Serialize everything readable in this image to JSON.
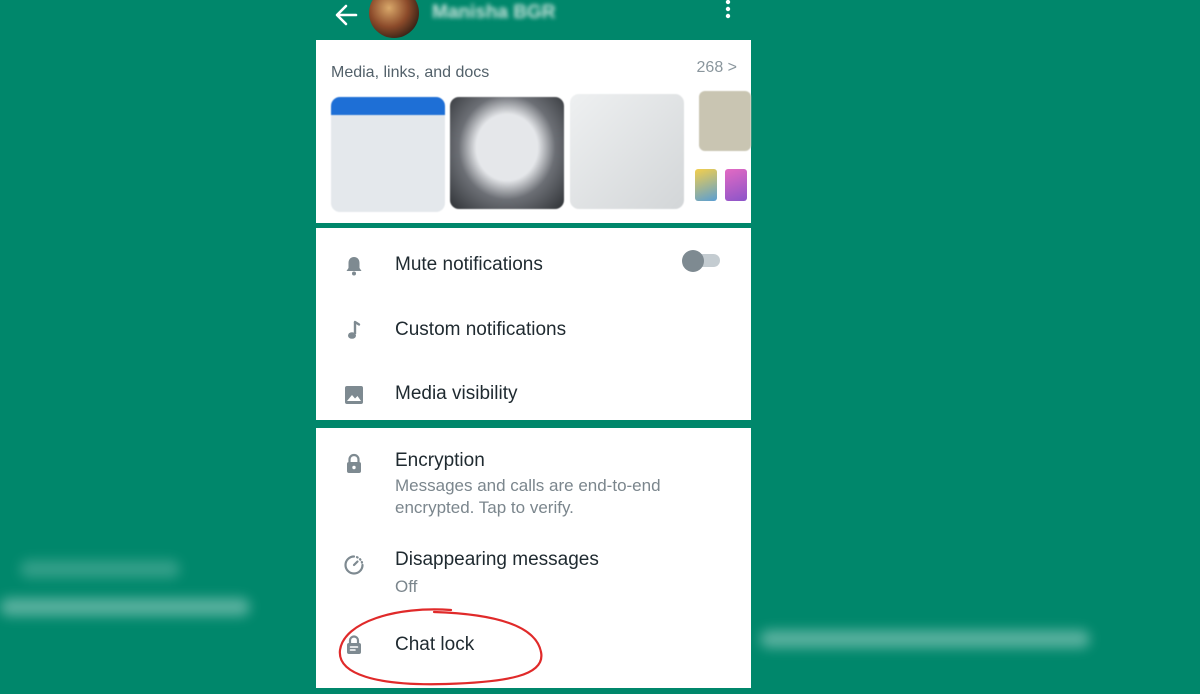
{
  "colors": {
    "background": "#00876b",
    "icon": "#7e8a91",
    "accent_annotation": "#e02a2a"
  },
  "header": {
    "back_icon": "arrow-left-icon",
    "contact_name": "Manisha BGR",
    "menu_icon": "more-vertical-icon"
  },
  "media": {
    "title": "Media, links, and docs",
    "count": "268 >"
  },
  "settings": {
    "mute": {
      "label": "Mute notifications",
      "icon": "bell-icon",
      "enabled": false
    },
    "custom": {
      "label": "Custom notifications",
      "icon": "music-note-icon"
    },
    "visibility": {
      "label": "Media visibility",
      "icon": "image-icon"
    }
  },
  "privacy": {
    "encryption": {
      "label": "Encryption",
      "sub": "Messages and calls are end-to-end encrypted. Tap to verify.",
      "icon": "lock-icon"
    },
    "disappearing": {
      "label": "Disappearing messages",
      "sub": "Off",
      "icon": "timer-icon"
    },
    "chat_lock": {
      "label": "Chat lock",
      "icon": "chat-lock-icon"
    }
  }
}
